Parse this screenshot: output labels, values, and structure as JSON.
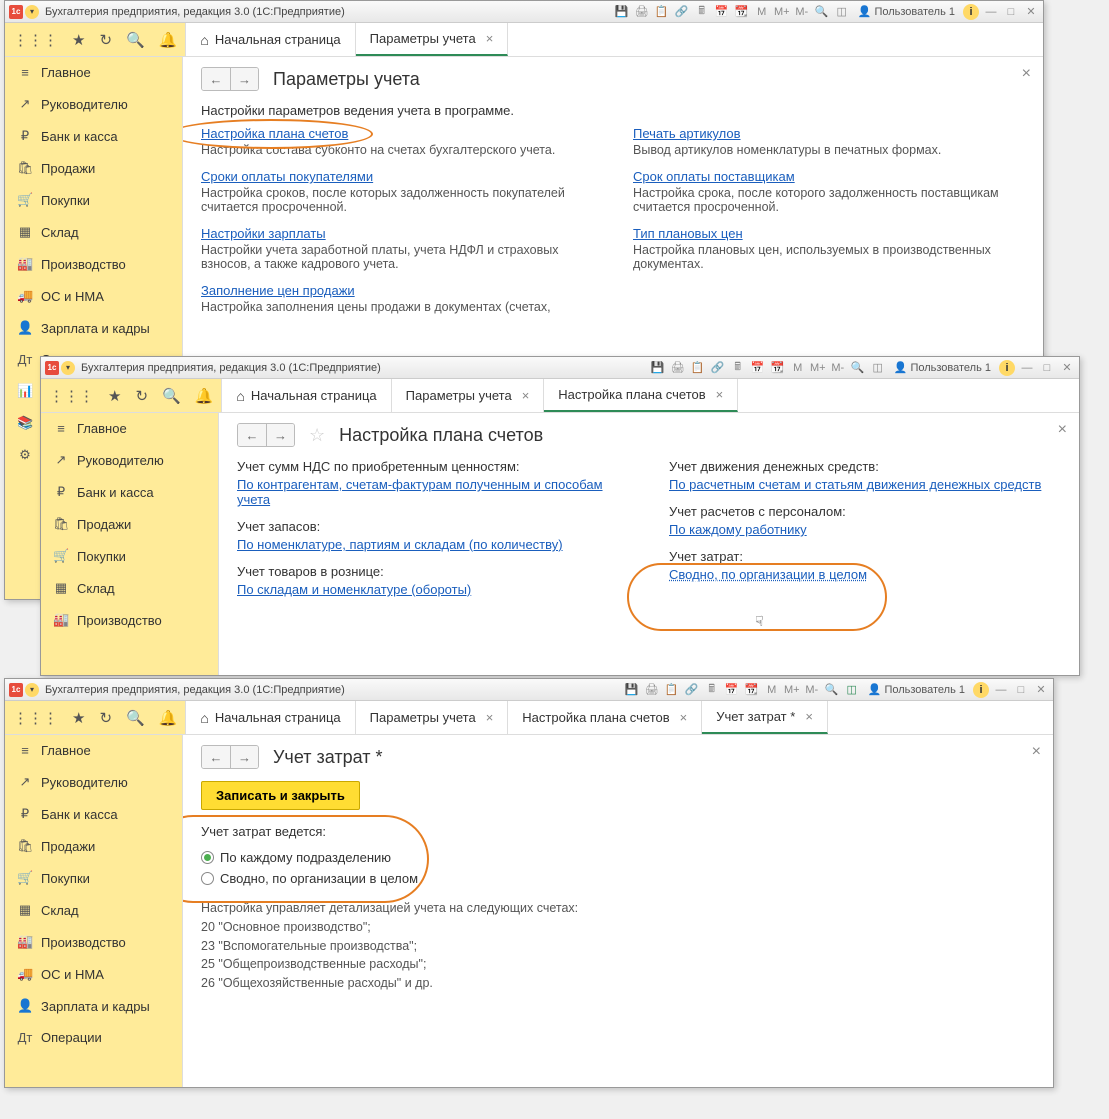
{
  "app_title": "Бухгалтерия предприятия, редакция 3.0  (1С:Предприятие)",
  "user": "Пользователь 1",
  "tb_zoom": [
    "M",
    "M+",
    "M-"
  ],
  "sidebar": [
    {
      "icon": "≡",
      "label": "Главное"
    },
    {
      "icon": "↗",
      "label": "Руководителю"
    },
    {
      "icon": "₽",
      "label": "Банк и касса"
    },
    {
      "icon": "🛍",
      "label": "Продажи"
    },
    {
      "icon": "🛒",
      "label": "Покупки"
    },
    {
      "icon": "▦",
      "label": "Склад"
    },
    {
      "icon": "🏭",
      "label": "Производство"
    },
    {
      "icon": "🚚",
      "label": "ОС и НМА"
    },
    {
      "icon": "👤",
      "label": "Зарплата и кадры"
    },
    {
      "icon": "Дт",
      "label": "Операции"
    },
    {
      "icon": "📊",
      "label": "Отчеты"
    },
    {
      "icon": "📚",
      "label": "Справочники"
    },
    {
      "icon": "⚙",
      "label": "Администрирование"
    }
  ],
  "win1": {
    "tabs": [
      {
        "label": "Начальная страница",
        "home": true
      },
      {
        "label": "Параметры учета",
        "close": true,
        "active": true
      }
    ],
    "title": "Параметры учета",
    "intro": "Настройки параметров ведения учета в программе.",
    "left": [
      {
        "link": "Настройка плана счетов",
        "desc": "Настройка состава субконто на счетах бухгалтерского учета."
      },
      {
        "link": "Сроки оплаты покупателями",
        "desc": "Настройка сроков, после которых задолженность покупателей считается просроченной."
      },
      {
        "link": "Настройки зарплаты",
        "desc": "Настройки учета заработной платы, учета НДФЛ и страховых взносов, а также кадрового учета."
      },
      {
        "link": "Заполнение цен продажи",
        "desc": "Настройка заполнения цены продажи в документах (счетах,"
      }
    ],
    "right": [
      {
        "link": "Печать артикулов",
        "desc": "Вывод артикулов номенклатуры в печатных формах."
      },
      {
        "link": "Срок оплаты поставщикам",
        "desc": "Настройка срока, после которого задолженность поставщикам считается просроченной."
      },
      {
        "link": "Тип плановых цен",
        "desc": "Настройка плановых цен, используемых в производственных документах."
      }
    ]
  },
  "win2": {
    "tabs": [
      {
        "label": "Начальная страница",
        "home": true
      },
      {
        "label": "Параметры учета",
        "close": true
      },
      {
        "label": "Настройка плана счетов",
        "close": true,
        "active": true
      }
    ],
    "title": "Настройка плана счетов",
    "left": [
      {
        "label": "Учет сумм НДС по приобретенным ценностям:",
        "link": "По контрагентам, счетам-фактурам полученным и способам учета"
      },
      {
        "label": "Учет запасов:",
        "link": "По номенклатуре, партиям и складам (по количеству)"
      },
      {
        "label": "Учет товаров в рознице:",
        "link": "По складам и номенклатуре (обороты)"
      }
    ],
    "right": [
      {
        "label": "Учет движения денежных средств:",
        "link": "По расчетным счетам и статьям движения денежных средств"
      },
      {
        "label": "Учет расчетов с персоналом:",
        "link": "По каждому работнику"
      },
      {
        "label": "Учет затрат:",
        "link": "Сводно, по организации в целом",
        "dotted": true
      }
    ]
  },
  "win3": {
    "tabs": [
      {
        "label": "Начальная страница",
        "home": true
      },
      {
        "label": "Параметры учета",
        "close": true
      },
      {
        "label": "Настройка плана счетов",
        "close": true
      },
      {
        "label": "Учет затрат *",
        "close": true,
        "active": true
      }
    ],
    "title": "Учет затрат *",
    "save_btn": "Записать и закрыть",
    "group_label": "Учет затрат ведется:",
    "radios": [
      {
        "label": "По каждому подразделению",
        "checked": true
      },
      {
        "label": "Сводно, по организации в целом",
        "checked": false
      }
    ],
    "note_intro": "Настройка управляет детализацией учета на следующих счетах:",
    "note_lines": [
      "20 \"Основное производство\";",
      "23 \"Вспомогательные производства\";",
      "25 \"Общепроизводственные расходы\";",
      "26 \"Общехозяйственные расходы\" и др."
    ]
  }
}
